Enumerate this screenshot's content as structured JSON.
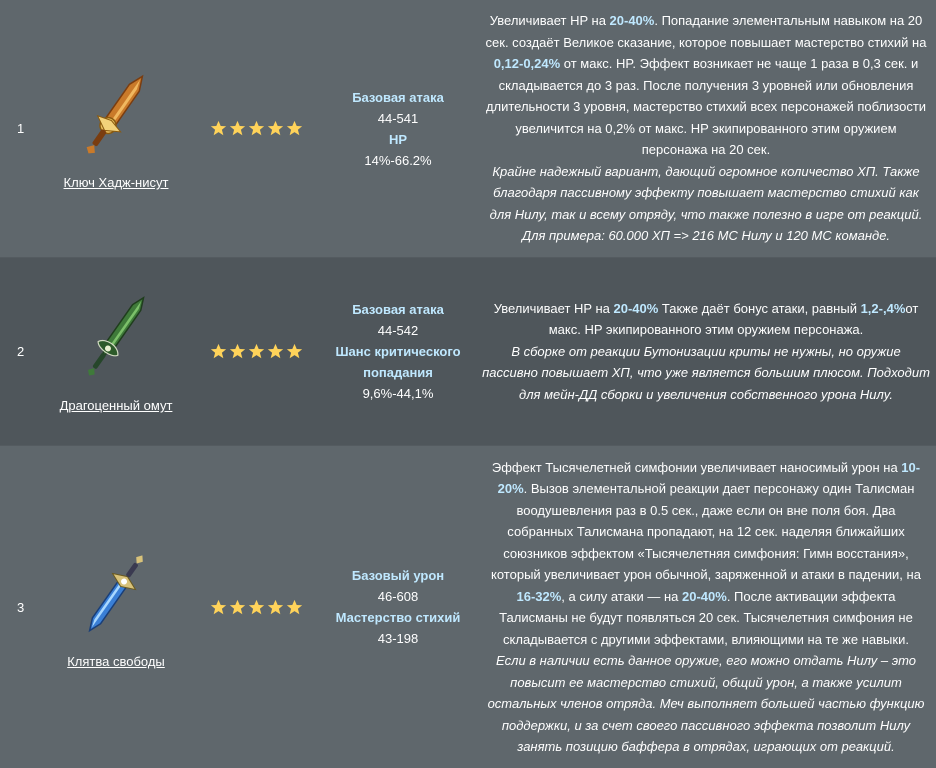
{
  "rows": [
    {
      "number": "1",
      "weapon_name": "Ключ Хадж-нисут",
      "icon": "golden-sword-icon",
      "stars": 5,
      "stat1_label": "Базовая атака",
      "stat1_value": "44-541",
      "stat2_label": "HP",
      "stat2_value": "14%-66.2%",
      "desc": {
        "a": "Увеличивает HP на ",
        "b": "20-40%",
        "c": ". Попадание элементальным навыком на 20 сек. создаёт Великое сказание, которое повышает мастерство стихий на ",
        "d": "0,12-0,24%",
        "e": " от макс. HP. Эффект возникает не чаще 1 раза в 0,3 сек. и складывается до 3 раз. После получения 3 уровней или обновления длительности 3 уровня, мастерство стихий всех персонажей поблизости увеличится на 0,2% от макс. HP экипированного этим оружием персонажа на 20 сек.",
        "note": "Крайне надежный вариант, дающий огромное количество ХП. Также благодаря пассивному эффекту повышает мастерство стихий как для Нилу, так и всему отряду, что также полезно в игре от реакций. Для примера: 60.000 ХП => 216 МС Нилу и 120 МС команде."
      }
    },
    {
      "number": "2",
      "weapon_name": "Драгоценный омут",
      "icon": "green-sword-icon",
      "stars": 5,
      "stat1_label": "Базовая атака",
      "stat1_value": "44-542",
      "stat2_label": "Шанс критического попадания",
      "stat2_value": "9,6%-44,1%",
      "desc": {
        "a": "Увеличивает HP на ",
        "b": "20-40%",
        "c": " Также даёт бонус атаки, равный ",
        "d": "1,2-,4%",
        "e": "от макс. HP экипированного этим оружием персонажа.",
        "note": "В сборке от реакции Бутонизации криты не нужны, но оружие пассивно повышает ХП, что уже является большим плюсом. Подходит для мейн-ДД сборки и увеличения собственного урона Нилу."
      }
    },
    {
      "number": "3",
      "weapon_name": "Клятва свободы",
      "icon": "blue-sword-icon",
      "stars": 5,
      "stat1_label": "Базовый урон",
      "stat1_value": "46-608",
      "stat2_label": "Мастерство стихий",
      "stat2_value": "43-198",
      "desc": {
        "a": "Эффект Тысячелетней симфонии увеличивает наносимый урон на ",
        "b": "10-20%",
        "c": ". Вызов элементальной реакции дает персонажу один Талисман воодушевления раз в 0.5 сек., даже если он вне поля боя. Два собранных Талисмана пропадают, на 12 сек. наделяя ближайших союзников эффектом «Тысячелетняя симфония: Гимн восстания», который увеличивает урон обычной, заряженной и атаки в падении, на ",
        "d": "16-32%",
        "e1": ", а силу атаки — на ",
        "f": "20-40%",
        "e": ". После активации эффекта Талисманы не будут появляться 20 сек. Тысячелетния симфония не складывается с другими эффектами, влияющими на те же навыки.",
        "note": "Если в наличии есть данное оружие, его можно отдать Нилу – это повысит ее мастерство стихий, общий урон, а также усилит остальных членов отряда. Меч выполняет большей частью функцию поддержки, и за счет своего пассивного эффекта позволит Нилу занять позицию баффера в отрядах, играющих от реакций."
      }
    }
  ],
  "colors": {
    "background": "#5f676c",
    "alt_row": "#4f565b",
    "highlight": "#bfe8ff",
    "star": "#ffd35a"
  }
}
